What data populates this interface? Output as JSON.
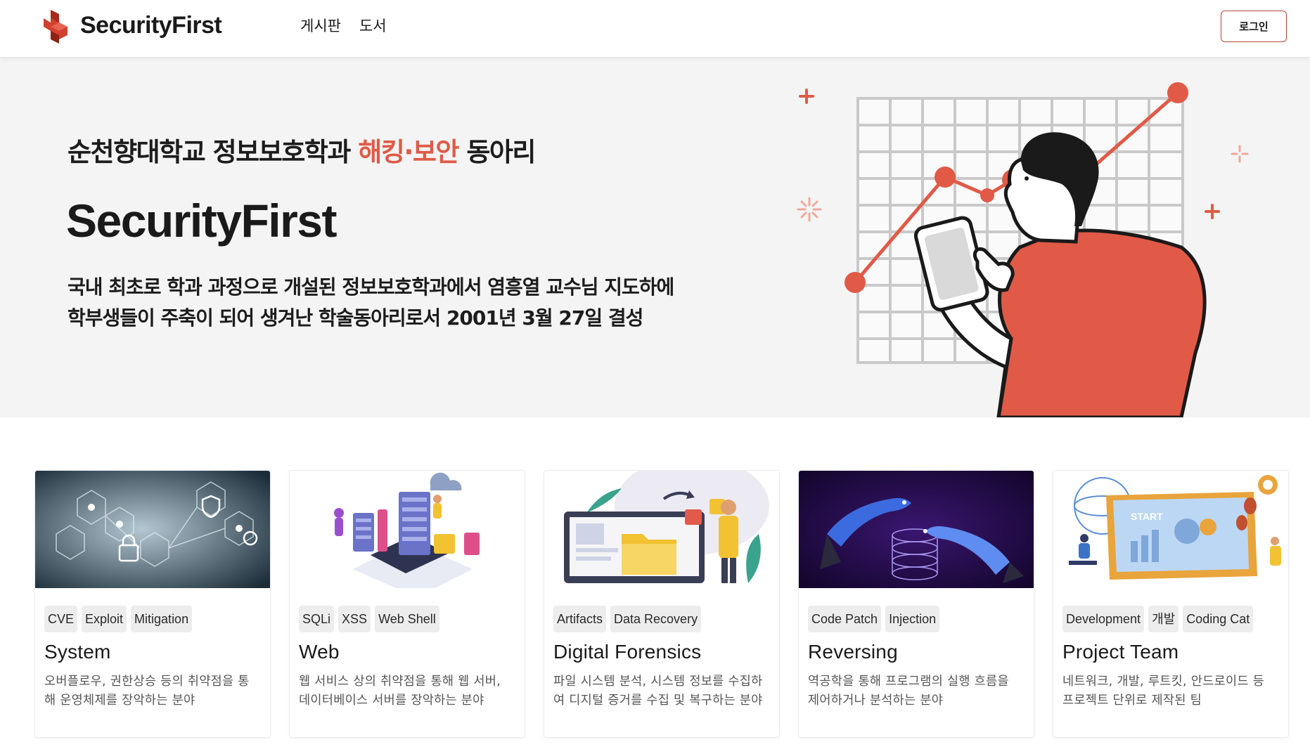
{
  "header": {
    "brand": "SecurityFirst",
    "nav": [
      "게시판",
      "도서"
    ],
    "login_label": "로그인"
  },
  "hero": {
    "tagline_prefix": "순천향대학교 정보보호학과 ",
    "tagline_accent": "해킹·보안",
    "tagline_suffix": " 동아리",
    "title": "SecurityFirst",
    "desc_line1": "국내 최초로 학과 과정으로 개설된 정보보호학과에서 염흥열 교수님 지도하에",
    "desc_line2": "학부생들이 주축이 되어 생겨난 학술동아리로서 2001년 3월 27일 결성"
  },
  "cards": [
    {
      "tags": [
        "CVE",
        "Exploit",
        "Mitigation"
      ],
      "title": "System",
      "desc": "오버플로우, 권한상승 등의 취약점을 통해 운영체제를 장악하는 분야",
      "image": "system-network-illustration"
    },
    {
      "tags": [
        "SQLi",
        "XSS",
        "Web Shell"
      ],
      "title": "Web",
      "desc": "웹 서비스 상의 취약점을 통해 웹 서버, 데이터베이스 서버를 장악하는 분야",
      "image": "web-server-illustration"
    },
    {
      "tags": [
        "Artifacts",
        "Data Recovery"
      ],
      "title": "Digital Forensics",
      "desc": "파일 시스템 분석, 시스템 정보를 수집하여 디지털 증거를 수집 및 복구하는 분야",
      "image": "forensics-illustration"
    },
    {
      "tags": [
        "Code Patch",
        "Injection"
      ],
      "title": "Reversing",
      "desc": "역공학을 통해 프로그램의 실행 흐름을 제어하거나 분석하는 분야",
      "image": "reversing-illustration"
    },
    {
      "tags": [
        "Development",
        "개발",
        "Coding Cat"
      ],
      "title": "Project Team",
      "desc": "네트워크, 개발, 루트킷, 안드로이드 등 프로젝트 단위로 제작된 팀",
      "image": "project-illustration"
    }
  ],
  "colors": {
    "accent": "#e05a47",
    "hero_bg": "#f4f4f4"
  }
}
